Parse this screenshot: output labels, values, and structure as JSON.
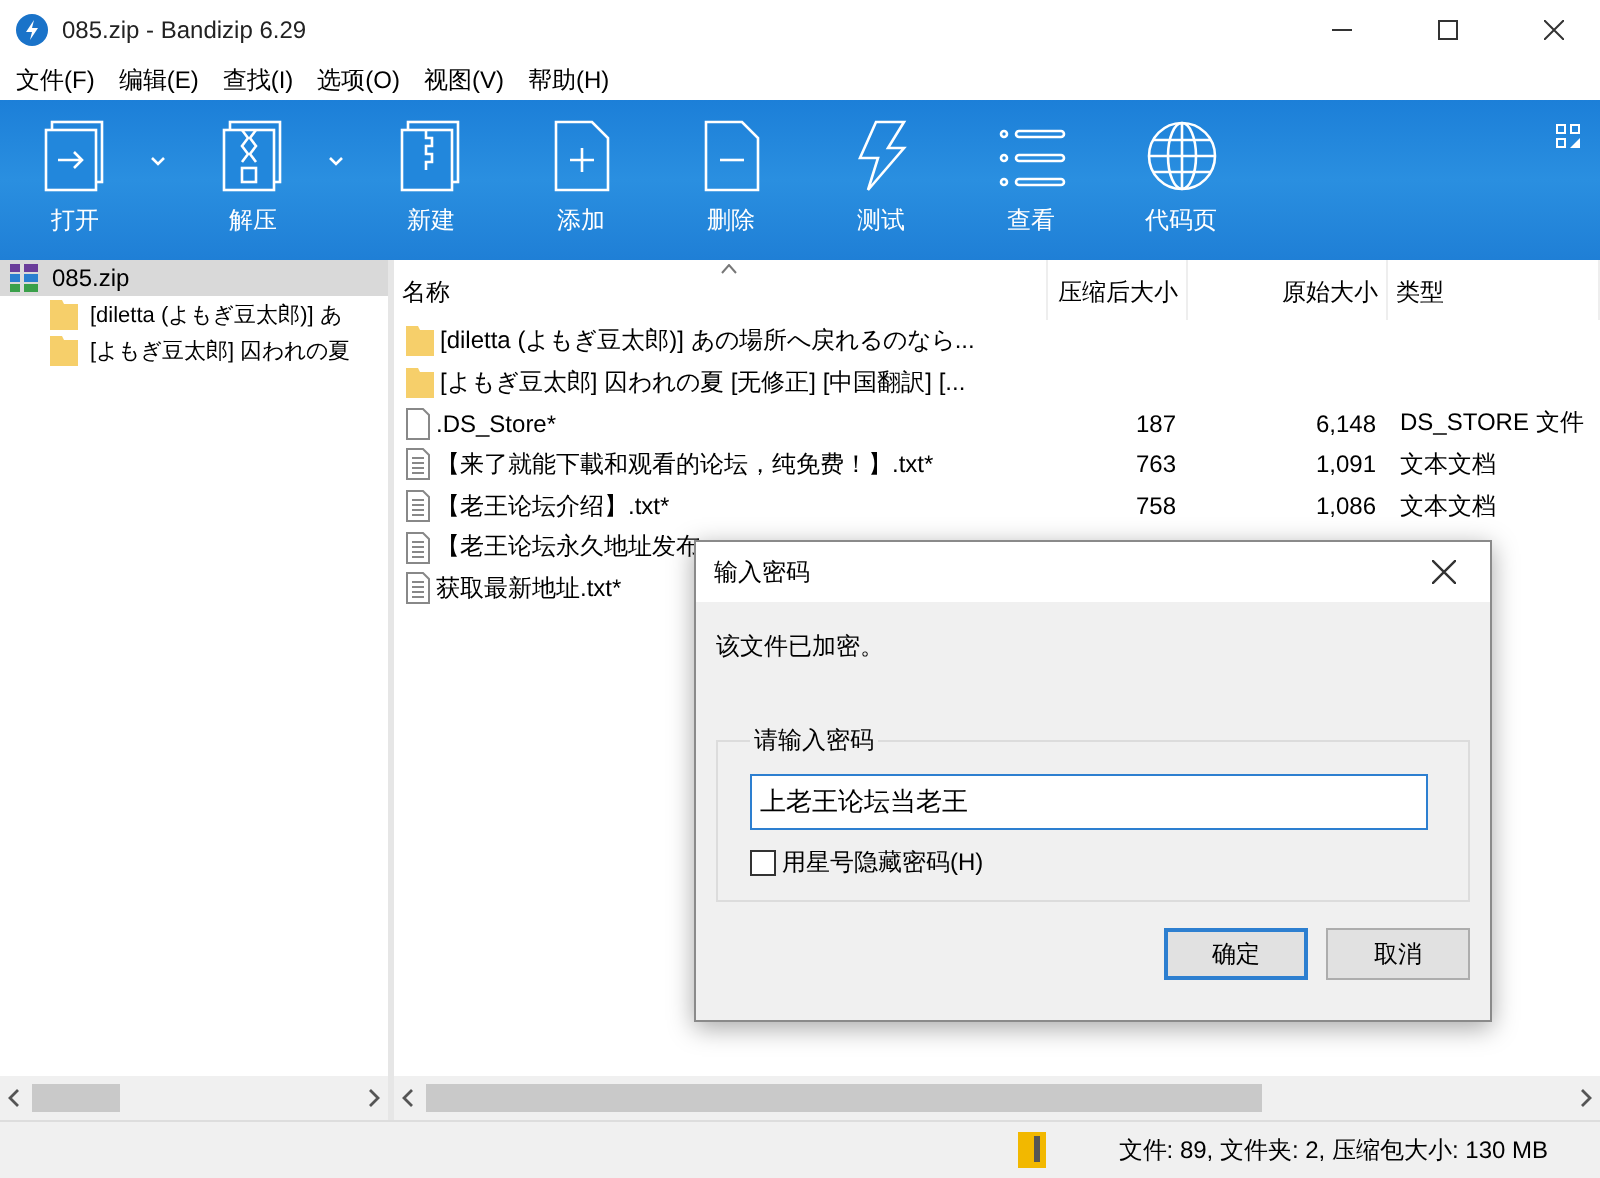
{
  "window": {
    "title": "085.zip - Bandizip 6.29"
  },
  "menu": [
    "文件(F)",
    "编辑(E)",
    "查找(I)",
    "选项(O)",
    "视图(V)",
    "帮助(H)"
  ],
  "toolbar": [
    {
      "kind": "open",
      "label": "打开",
      "dropdown": true
    },
    {
      "kind": "extract",
      "label": "解压",
      "dropdown": true
    },
    {
      "kind": "new",
      "label": "新建",
      "dropdown": false
    },
    {
      "kind": "add",
      "label": "添加",
      "dropdown": false
    },
    {
      "kind": "delete",
      "label": "删除",
      "dropdown": false
    },
    {
      "kind": "test",
      "label": "测试",
      "dropdown": false
    },
    {
      "kind": "view",
      "label": "查看",
      "dropdown": false
    },
    {
      "kind": "codepage",
      "label": "代码页",
      "dropdown": false
    }
  ],
  "tree": {
    "label": "085.zip",
    "selected": true,
    "children": [
      {
        "label": "[diletta (よもぎ豆太郎)] あ",
        "selected": false
      },
      {
        "label": "[よもぎ豆太郎] 囚われの夏",
        "selected": false
      }
    ]
  },
  "file_list": {
    "columns": [
      {
        "label": "名称",
        "sorted": true
      },
      {
        "label": "压缩后大小",
        "sorted": false
      },
      {
        "label": "原始大小",
        "sorted": false
      },
      {
        "label": "类型",
        "sorted": false
      }
    ],
    "rows": [
      {
        "kind": "folder",
        "name": "[diletta (よもぎ豆太郎)] あの場所へ戻れるのなら...",
        "compressed": "",
        "original": "",
        "type": ""
      },
      {
        "kind": "folder",
        "name": "[よもぎ豆太郎] 囚われの夏 [无修正] [中国翻訳] [...",
        "compressed": "",
        "original": "",
        "type": ""
      },
      {
        "kind": "blank",
        "name": ".DS_Store*",
        "compressed": "187",
        "original": "6,148",
        "type": "DS_STORE 文件"
      },
      {
        "kind": "text",
        "name": "【来了就能下載和观看的论坛，纯免费！】.txt*",
        "compressed": "763",
        "original": "1,091",
        "type": "文本文档"
      },
      {
        "kind": "text",
        "name": "【老王论坛介绍】.txt*",
        "compressed": "758",
        "original": "1,086",
        "type": "文本文档"
      },
      {
        "kind": "text",
        "name": "【老王论坛永久地址发布",
        "compressed": "",
        "original": "",
        "type": ""
      },
      {
        "kind": "text",
        "name": "获取最新地址.txt*",
        "compressed": "",
        "original": "",
        "type": ""
      }
    ]
  },
  "status_bar": {
    "text": "文件: 89, 文件夹: 2, 压缩包大小: 130 MB"
  },
  "dialog": {
    "title": "输入密码",
    "message": "该文件已加密。",
    "group_label": "请输入密码",
    "password": "上老王论坛当老王",
    "hide_checkbox": {
      "label": "用星号隐藏密码(H)",
      "checked": false
    },
    "buttons": [
      {
        "label": "确定",
        "default": true
      },
      {
        "label": "取消",
        "default": false
      }
    ]
  }
}
